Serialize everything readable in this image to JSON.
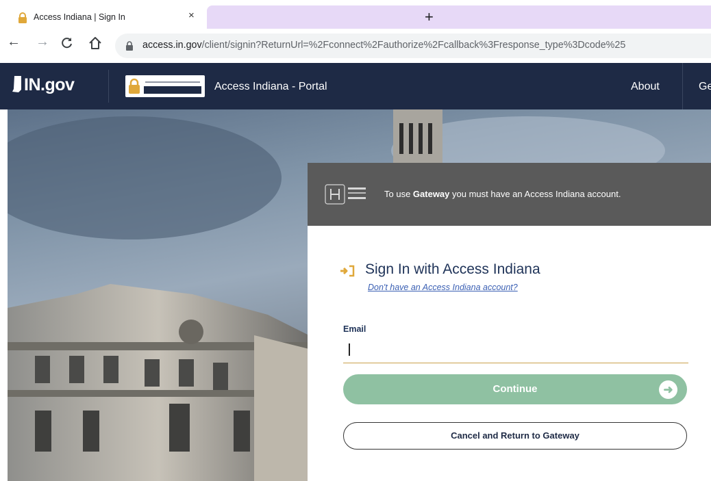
{
  "browser": {
    "tab_title": "Access Indiana | Sign In",
    "tab_close": "×",
    "new_tab": "+",
    "url_host": "access.in.gov",
    "url_path": "/client/signin?ReturnUrl=%2Fconnect%2Fauthorize%2Fcallback%3Fresponse_type%3Dcode%25"
  },
  "header": {
    "logo_text": "IN.gov",
    "access_indiana_logo": "ACCESS INDIANA",
    "portal_title": "Access Indiana - Portal",
    "nav_about": "About",
    "nav_next": "Ge"
  },
  "notice": {
    "prefix": "To use ",
    "app": "Gateway",
    "suffix": " you must have an Access Indiana account."
  },
  "signin": {
    "title": "Sign In with Access Indiana",
    "signup_link": "Don't have an Access Indiana account?",
    "email_label": "Email",
    "email_value": "",
    "continue_label": "Continue",
    "cancel_label": "Cancel and Return to Gateway"
  },
  "colors": {
    "header_bg": "#1e2a45",
    "accent_gold": "#e0a83a",
    "continue_green": "#8fc1a2",
    "title_navy": "#203459"
  }
}
